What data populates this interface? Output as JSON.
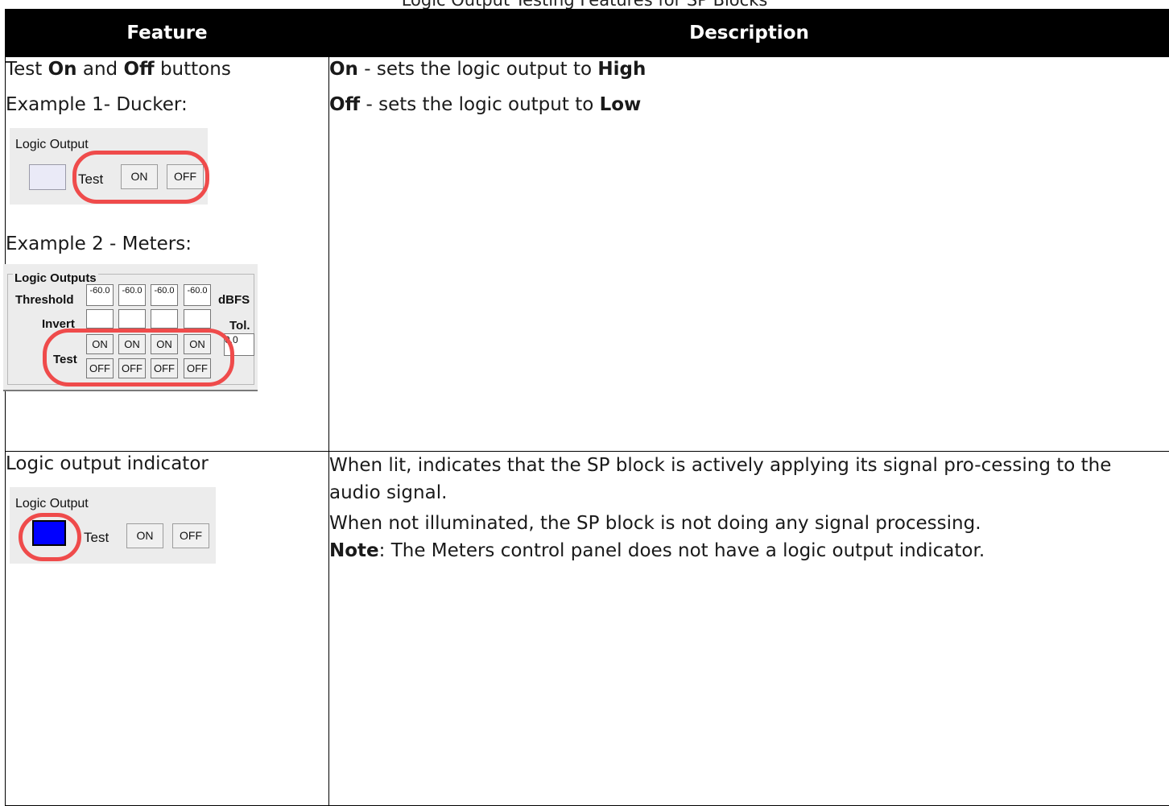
{
  "caption": "Logic Output Testing Features for SP Blocks",
  "table": {
    "headers": {
      "feature": "Feature",
      "description": "Description"
    },
    "row1": {
      "feature_pre": "Test ",
      "feature_on": "On",
      "feature_mid": " and ",
      "feature_off": "Off",
      "feature_post": " buttons",
      "example1": "Example 1- Ducker:",
      "example2": "Example 2 - Meters:",
      "desc_on_label": "On",
      "desc_on_text": " - sets the logic output to ",
      "desc_on_value": "High",
      "desc_off_label": "Off",
      "desc_off_text": " - sets the logic output to ",
      "desc_off_value": "Low"
    },
    "row2": {
      "feature": "Logic output indicator",
      "desc_p1": "When lit, indicates that the SP block is actively applying its signal pro-cessing to the audio signal.",
      "desc_p2": "When not illuminated, the SP block is not doing any signal processing.",
      "note_label": "Note",
      "note_text": ": The Meters control panel does not have a logic output indicator."
    }
  },
  "ducker_panel": {
    "title": "Logic Output",
    "test_label": "Test",
    "on_label": "ON",
    "off_label": "OFF",
    "indicator_lit": false
  },
  "meters_panel": {
    "title": "Logic Outputs",
    "threshold_label": "Threshold",
    "thresholds": [
      "-60.0",
      "-60.0",
      "-60.0",
      "-60.0"
    ],
    "unit": "dBFS",
    "invert_label": "Invert",
    "tol_label": "Tol.",
    "tol_value": "0.0",
    "test_label": "Test",
    "on_label": "ON",
    "off_label": "OFF"
  },
  "indicator_panel": {
    "title": "Logic Output",
    "test_label": "Test",
    "on_label": "ON",
    "off_label": "OFF",
    "indicator_lit": true,
    "indicator_color": "#0000ff"
  },
  "colors": {
    "highlight_ring": "#ef4b4b",
    "header_bg": "#000000"
  }
}
